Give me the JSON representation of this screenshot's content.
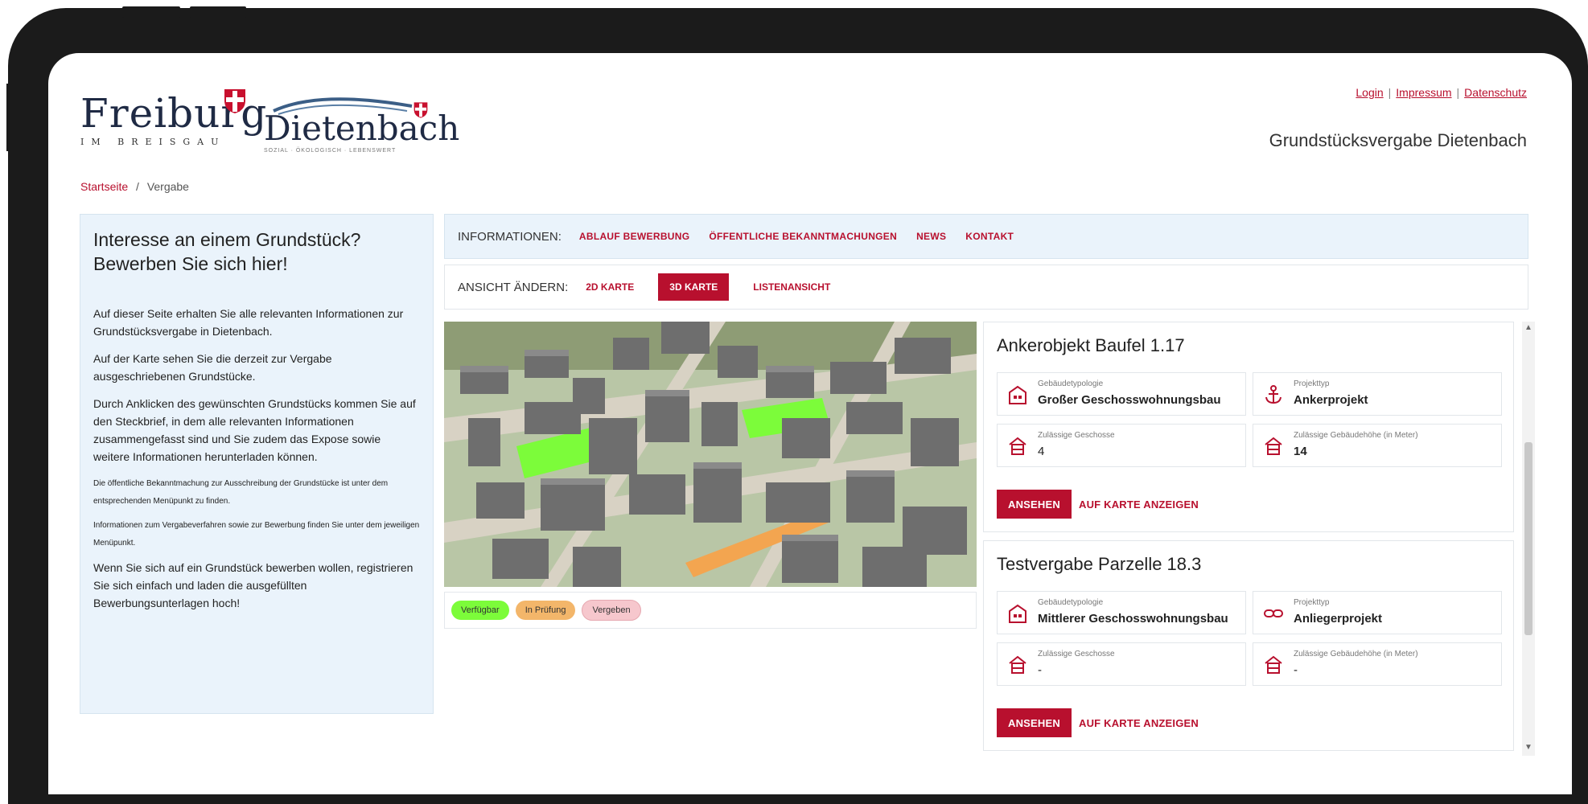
{
  "header": {
    "logo_freiburg": "Freiburg",
    "logo_freiburg_sub": "IM BREISGAU",
    "logo_dietenbach": "Dietenbach",
    "logo_dietenbach_sub": "SOZIAL · ÖKOLOGISCH · LEBENSWERT",
    "links": [
      "Login",
      "Impressum",
      "Datenschutz"
    ],
    "site_title": "Grundstücksvergabe Dietenbach"
  },
  "breadcrumb": {
    "home": "Startseite",
    "separator": "/",
    "current": "Vergabe"
  },
  "sidebar": {
    "heading": "Interesse an einem Grundstück? Bewerben Sie sich hier!",
    "p1": "Auf dieser Seite erhalten Sie alle relevanten Informationen zur Grundstücksvergabe in Dietenbach.",
    "p2": "Auf der Karte sehen Sie die derzeit zur Vergabe ausgeschriebenen Grundstücke.",
    "p3": "Durch Anklicken des gewünschten Grundstücks kommen Sie auf den Steckbrief, in dem alle relevanten Informationen zusammengefasst sind und Sie zudem das Expose sowie weitere Informationen herunterladen können.",
    "p4": "Die öffentliche Bekanntmachung zur Ausschreibung der Grundstücke ist unter dem entsprechenden Menüpunkt zu finden.",
    "p5": "Informationen zum Vergabeverfahren sowie zur Bewerbung finden Sie unter dem jeweiligen Menüpunkt.",
    "p6": "Wenn Sie sich auf ein Grundstück bewerben wollen, registrieren Sie sich einfach und laden die ausgefüllten Bewerbungsunterlagen hoch!"
  },
  "infobar": {
    "label": "INFORMATIONEN:",
    "links": [
      "ABLAUF BEWERBUNG",
      "ÖFFENTLICHE BEKANNTMACHUNGEN",
      "NEWS",
      "KONTAKT"
    ]
  },
  "viewbar": {
    "label": "ANSICHT ÄNDERN:",
    "options": [
      "2D KARTE",
      "3D KARTE",
      "LISTENANSICHT"
    ],
    "active": "3D KARTE"
  },
  "legend": [
    {
      "label": "Verfügbar",
      "color": "#7cfc3a"
    },
    {
      "label": "In Prüfung",
      "color": "#f3b66a"
    },
    {
      "label": "Vergeben",
      "color": "#f6c7cd"
    }
  ],
  "cards": [
    {
      "title": "Ankerobjekt Baufel 1.17",
      "typologie_label": "Gebäudetypologie",
      "typologie_value": "Großer Geschosswohnungsbau",
      "projekttyp_label": "Projekttyp",
      "projekttyp_value": "Ankerprojekt",
      "geschosse_label": "Zulässige Geschosse",
      "geschosse_value": "4",
      "hoehe_label": "Zulässige Gebäudehöhe (in Meter)",
      "hoehe_value": "14",
      "view_button": "ANSEHEN",
      "map_button": "AUF KARTE ANZEIGEN"
    },
    {
      "title": "Testvergabe Parzelle 18.3",
      "typologie_label": "Gebäudetypologie",
      "typologie_value": "Mittlerer Geschosswohnungsbau",
      "projekttyp_label": "Projekttyp",
      "projekttyp_value": "Anliegerprojekt",
      "geschosse_label": "Zulässige Geschosse",
      "geschosse_value": "-",
      "hoehe_label": "Zulässige Gebäudehöhe (in Meter)",
      "hoehe_value": "-",
      "view_button": "ANSEHEN",
      "map_button": "AUF KARTE ANZEIGEN"
    }
  ],
  "colors": {
    "accent": "#b8102e",
    "panel": "#eaf3fb",
    "frame": "#1b1b1b"
  }
}
